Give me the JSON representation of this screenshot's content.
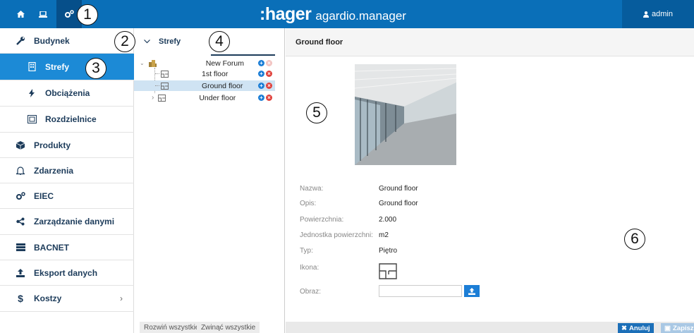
{
  "header": {
    "brand_logo": ":hager",
    "brand_app": "agardio.manager",
    "user_label": "admin",
    "nav_icons": [
      "home-icon",
      "laptop-icon",
      "gears-icon"
    ]
  },
  "sidebar": {
    "items": [
      {
        "label": "Budynek",
        "icon": "wrench-icon"
      },
      {
        "label": "Strefy",
        "icon": "building-icon"
      },
      {
        "label": "Obciążenia",
        "icon": "bolt-icon"
      },
      {
        "label": "Rozdzielnice",
        "icon": "panel-icon"
      },
      {
        "label": "Produkty",
        "icon": "cube-icon"
      },
      {
        "label": "Zdarzenia",
        "icon": "bell-icon"
      },
      {
        "label": "EIEC",
        "icon": "gears-icon"
      },
      {
        "label": "Zarządzanie danymi",
        "icon": "share-icon"
      },
      {
        "label": "BACNET",
        "icon": "server-icon"
      },
      {
        "label": "Eksport danych",
        "icon": "upload-icon"
      },
      {
        "label": "Kostzy",
        "icon": "dollar-icon",
        "chevron": "›"
      }
    ]
  },
  "tree": {
    "title": "Strefy",
    "nodes": [
      {
        "label": "New Forum"
      },
      {
        "label": "1st floor"
      },
      {
        "label": "Ground floor"
      },
      {
        "label": "Under floor"
      }
    ],
    "expand_all": "Rozwiń wszystkie",
    "collapse_all": "Zwinąć wszystkie"
  },
  "detail": {
    "title": "Ground floor",
    "fields": [
      {
        "label": "Nazwa:",
        "value": "Ground floor"
      },
      {
        "label": "Opis:",
        "value": "Ground floor"
      },
      {
        "label": "Powierzchnia:",
        "value": "2.000"
      },
      {
        "label": "Jednostka powierzchni:",
        "value": "m2"
      },
      {
        "label": "Typ:",
        "value": "Piętro"
      },
      {
        "label": "Ikona:",
        "value": ""
      },
      {
        "label": "Obraz:",
        "value": ""
      }
    ],
    "cancel_label": "Anuluj",
    "save_label": "Zapisz"
  },
  "callouts": [
    "1",
    "2",
    "3",
    "4",
    "5",
    "6"
  ],
  "colors": {
    "brand": "#0a6fb8",
    "active": "#1c8ad6",
    "add": "#1c7ed6",
    "remove": "#e0413c"
  }
}
